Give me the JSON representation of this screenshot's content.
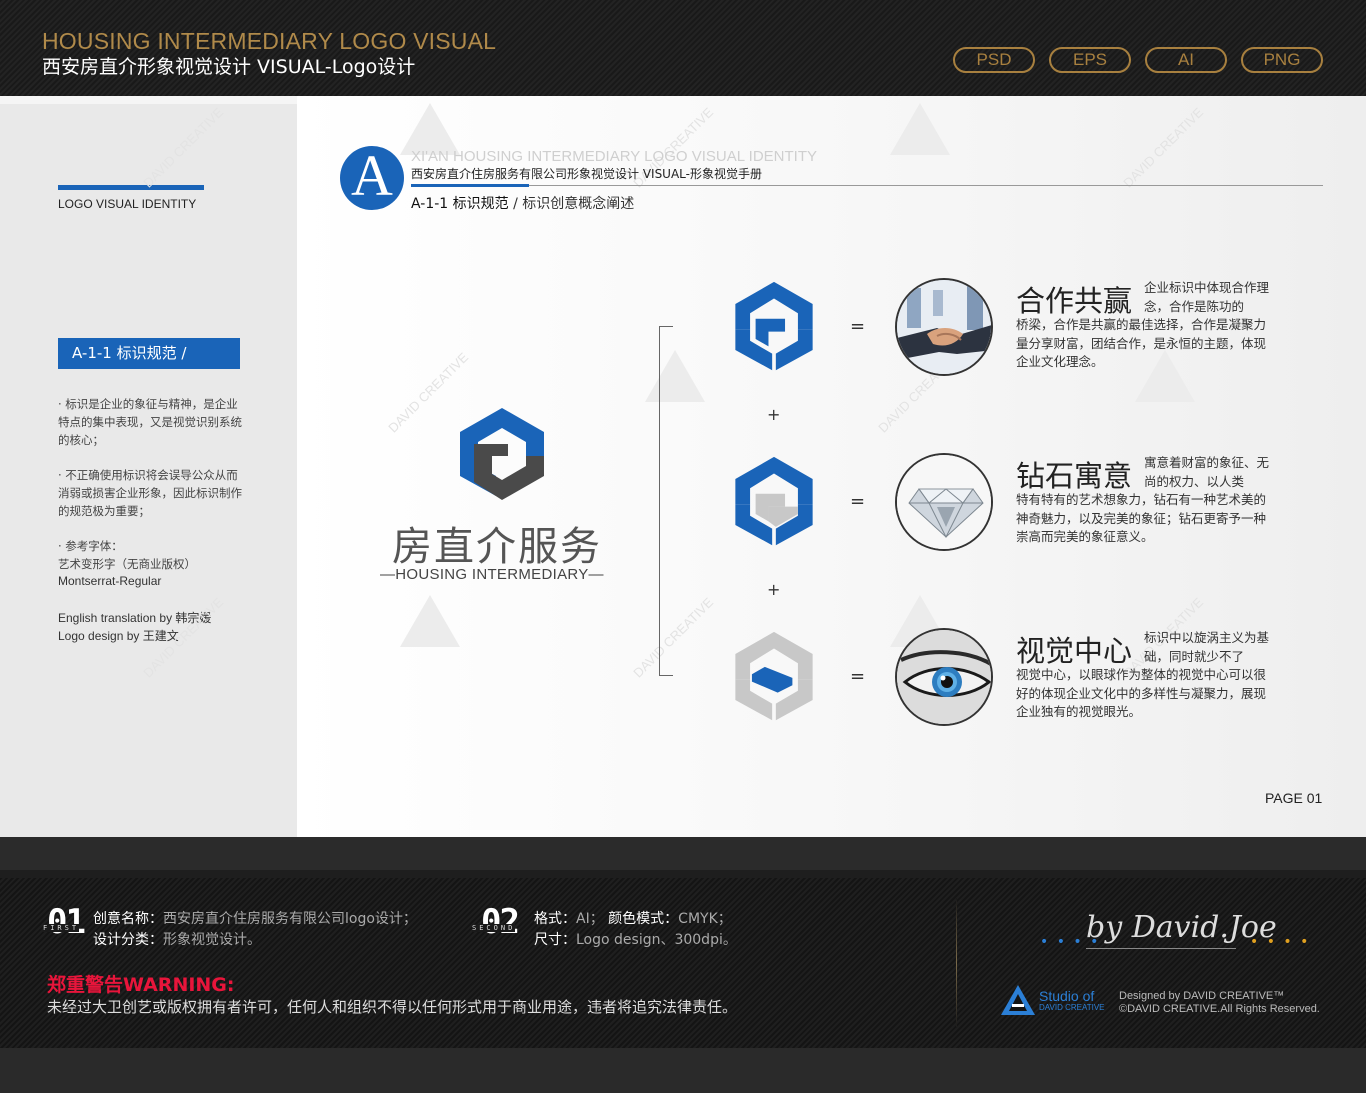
{
  "header": {
    "title_en": "HOUSING INTERMEDIARY LOGO VISUAL",
    "title_zh": "西安房直介形象视觉设计  VISUAL-Logo设计",
    "formats": [
      "PSD",
      "EPS",
      "AI",
      "PNG"
    ]
  },
  "sidebar": {
    "section_title": "LOGO VISUAL IDENTITY",
    "tab_label": "A-1-1 标识规范 /",
    "para1": "· 标识是企业的象征与精神，是企业特点的集中表现，又是视觉识别系统的核心；",
    "para2": "· 不正确使用标识将会误导公众从而消弱或损害企业形象，因此标识制作的规范极为重要；",
    "para3_line1": "· 参考字体：",
    "para3_line2": "艺术变形字（无商业版权）",
    "para3_line3": "Montserrat-Regular",
    "credit1": "English translation by 韩宗媛",
    "credit2": "Logo design by 王建文"
  },
  "doc_header": {
    "badge_letter": "A",
    "title_en": "XI'AN HOUSING INTERMEDIARY LOGO VISUAL IDENTITY",
    "title_zh": "西安房直介住房服务有限公司形象视觉设计  VISUAL-形象视觉手册",
    "section_bold": "A-1-1 标识规范",
    "section_rest": " / 标识创意概念阐述"
  },
  "brand": {
    "name_zh": "房直介服务",
    "name_en": "—HOUSING INTERMEDIARY—"
  },
  "concepts": [
    {
      "title": "合作共赢",
      "side": "企业标识中体现合作理念，合作是陈功的",
      "body": "桥梁，合作是共赢的最佳选择，合作是凝聚力量分享财富，团结合作，是永恒的主题，体现企业文化理念。"
    },
    {
      "title": "钻石寓意",
      "side": "寓意着财富的象征、无尚的权力、以人类",
      "body": "特有特有的艺术想象力，钻石有一种艺术美的神奇魅力，以及完美的象征；钻石更寄予一种崇高而完美的象征意义。"
    },
    {
      "title": "视觉中心",
      "side": "标识中以旋涡主义为基础，同时就少不了",
      "body": "视觉中心，以眼球作为整体的视觉中心可以很好的体现企业文化中的多样性与凝聚力，展现企业独有的视觉眼光。"
    }
  ],
  "symbols": {
    "plus": "+",
    "equals": "="
  },
  "page_number": "PAGE 01",
  "footer": {
    "num1": "01",
    "tag1": "FIRST",
    "label1a": "创意名称：",
    "value1a": "西安房直介住房服务有限公司logo设计；",
    "label1b": "设计分类：",
    "value1b": "形象视觉设计。",
    "num2": "02",
    "tag2": "SECOND",
    "label2a": "格式：",
    "value2a": "AI；",
    "label2c": "颜色模式：",
    "value2c": "CMYK；",
    "label2b": "尺寸：",
    "value2b": "Logo design、300dpi。",
    "warning_title": "郑重警告WARNING:",
    "warning_body": "未经过大卫创艺或版权拥有者许可，任何人和组织不得以任何形式用于商业用途，违者将追究法律责任。",
    "signature": "by David.Joe",
    "studio_line1": "Studio of",
    "studio_line2": "DAVID CREATIVE",
    "designed_by": "Designed by DAVID CREATIVE™",
    "copyright": "©DAVID CREATIVE.All Rights Reserved."
  },
  "watermark": "DAVID CREATIVE",
  "colors": {
    "brand_blue": "#1a64b8",
    "gold": "#a8803f",
    "warning_red": "#e8153b",
    "logo_grey": "#4a4a4a",
    "light_grey": "#c8c8c8"
  }
}
